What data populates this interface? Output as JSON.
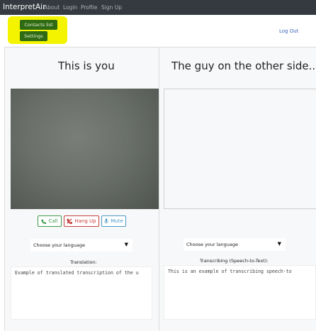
{
  "navbar": {
    "brand": "InterpretAir",
    "links": [
      "About",
      "Login",
      "Profile",
      "Sign Up"
    ]
  },
  "actions": {
    "contacts_label": "Contacts list",
    "settings_label": "Settings",
    "logout_label": "Log Out"
  },
  "left": {
    "title": "This is you",
    "buttons": {
      "call": "Call",
      "hangup": "Hang Up",
      "mute": "Mute"
    },
    "language_select": "Choose your language",
    "caption": "Translation:",
    "text": "Example of translated transcription of the u"
  },
  "right": {
    "title": "The guy on the other side...",
    "language_select": "Choose your language",
    "caption": "Transcribing (Speech-to-Text):",
    "text": "This is an example of transcribing speech-to"
  },
  "colors": {
    "navbar": "#343a40",
    "highlight": "#f4f400",
    "green_button": "#2e6b12",
    "call": "#3d9a4a",
    "hangup": "#c94040",
    "mute": "#4a98c4",
    "link": "#3a66b8"
  },
  "icons": {
    "call": "phone-icon",
    "hangup": "phone-slash-icon",
    "mute": "microphone-icon",
    "select": "caret-down-icon"
  }
}
